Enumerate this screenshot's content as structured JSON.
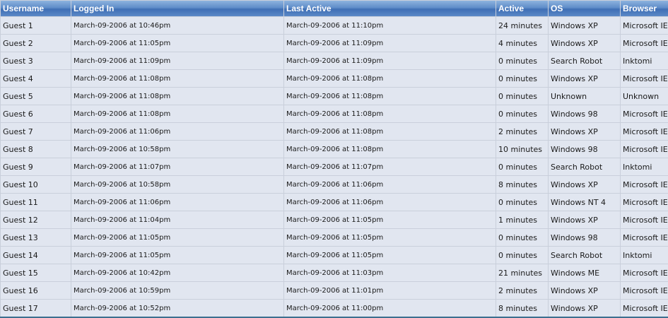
{
  "table": {
    "headers": {
      "username": "Username",
      "logged_in": "Logged In",
      "last_active": "Last Active",
      "active": "Active",
      "os": "OS",
      "browser": "Browser"
    },
    "rows": [
      {
        "username": "Guest 1",
        "logged_in": "March-09-2006 at 10:46pm",
        "last_active": "March-09-2006 at 11:10pm",
        "active": "24 minutes",
        "os": "Windows XP",
        "browser": "Microsoft IE"
      },
      {
        "username": "Guest 2",
        "logged_in": "March-09-2006 at 11:05pm",
        "last_active": "March-09-2006 at 11:09pm",
        "active": "4 minutes",
        "os": "Windows XP",
        "browser": "Microsoft IE"
      },
      {
        "username": "Guest 3",
        "logged_in": "March-09-2006 at 11:09pm",
        "last_active": "March-09-2006 at 11:09pm",
        "active": "0 minutes",
        "os": "Search Robot",
        "browser": "Inktomi"
      },
      {
        "username": "Guest 4",
        "logged_in": "March-09-2006 at 11:08pm",
        "last_active": "March-09-2006 at 11:08pm",
        "active": "0 minutes",
        "os": "Windows XP",
        "browser": "Microsoft IE"
      },
      {
        "username": "Guest 5",
        "logged_in": "March-09-2006 at 11:08pm",
        "last_active": "March-09-2006 at 11:08pm",
        "active": "0 minutes",
        "os": "Unknown",
        "browser": "Unknown"
      },
      {
        "username": "Guest 6",
        "logged_in": "March-09-2006 at 11:08pm",
        "last_active": "March-09-2006 at 11:08pm",
        "active": "0 minutes",
        "os": "Windows 98",
        "browser": "Microsoft IE"
      },
      {
        "username": "Guest 7",
        "logged_in": "March-09-2006 at 11:06pm",
        "last_active": "March-09-2006 at 11:08pm",
        "active": "2 minutes",
        "os": "Windows XP",
        "browser": "Microsoft IE"
      },
      {
        "username": "Guest 8",
        "logged_in": "March-09-2006 at 10:58pm",
        "last_active": "March-09-2006 at 11:08pm",
        "active": "10 minutes",
        "os": "Windows 98",
        "browser": "Microsoft IE"
      },
      {
        "username": "Guest 9",
        "logged_in": "March-09-2006 at 11:07pm",
        "last_active": "March-09-2006 at 11:07pm",
        "active": "0 minutes",
        "os": "Search Robot",
        "browser": "Inktomi"
      },
      {
        "username": "Guest 10",
        "logged_in": "March-09-2006 at 10:58pm",
        "last_active": "March-09-2006 at 11:06pm",
        "active": "8 minutes",
        "os": "Windows XP",
        "browser": "Microsoft IE"
      },
      {
        "username": "Guest 11",
        "logged_in": "March-09-2006 at 11:06pm",
        "last_active": "March-09-2006 at 11:06pm",
        "active": "0 minutes",
        "os": "Windows NT 4",
        "browser": "Microsoft IE"
      },
      {
        "username": "Guest 12",
        "logged_in": "March-09-2006 at 11:04pm",
        "last_active": "March-09-2006 at 11:05pm",
        "active": "1 minutes",
        "os": "Windows XP",
        "browser": "Microsoft IE"
      },
      {
        "username": "Guest 13",
        "logged_in": "March-09-2006 at 11:05pm",
        "last_active": "March-09-2006 at 11:05pm",
        "active": "0 minutes",
        "os": "Windows 98",
        "browser": "Microsoft IE"
      },
      {
        "username": "Guest 14",
        "logged_in": "March-09-2006 at 11:05pm",
        "last_active": "March-09-2006 at 11:05pm",
        "active": "0 minutes",
        "os": "Search Robot",
        "browser": "Inktomi"
      },
      {
        "username": "Guest 15",
        "logged_in": "March-09-2006 at 10:42pm",
        "last_active": "March-09-2006 at 11:03pm",
        "active": "21 minutes",
        "os": "Windows ME",
        "browser": "Microsoft IE"
      },
      {
        "username": "Guest 16",
        "logged_in": "March-09-2006 at 10:59pm",
        "last_active": "March-09-2006 at 11:01pm",
        "active": "2 minutes",
        "os": "Windows XP",
        "browser": "Microsoft IE"
      },
      {
        "username": "Guest 17",
        "logged_in": "March-09-2006 at 10:52pm",
        "last_active": "March-09-2006 at 11:00pm",
        "active": "8 minutes",
        "os": "Windows XP",
        "browser": "Microsoft IE"
      }
    ]
  }
}
